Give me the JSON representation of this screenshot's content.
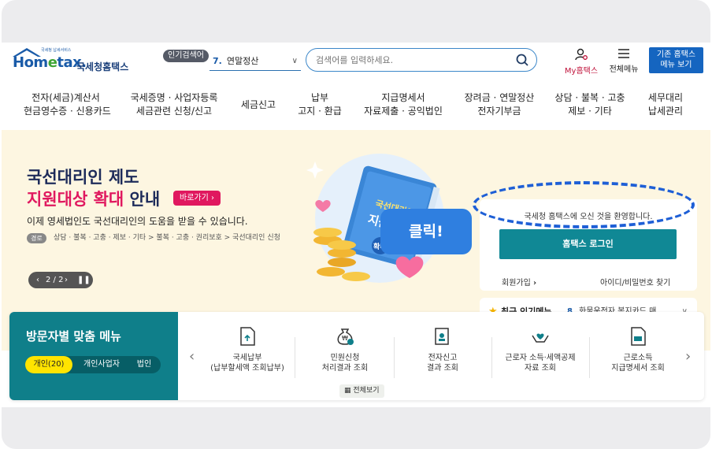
{
  "header": {
    "logo": {
      "brand_pre": "Hom",
      "brand_e": "e",
      "brand_post": "tax.",
      "brand_tiny": "국세청 납세서비스",
      "brand_ko": "국세청홈택스"
    },
    "popular_badge": "인기검색어",
    "popular_rank": "7.",
    "popular_term": "연말정산",
    "search": {
      "placeholder": "검색어를 입력하세요."
    },
    "my_hometax": "My홈택스",
    "all_menu": "전체메뉴",
    "legacy_line1": "기존 홈택스",
    "legacy_line2": "메뉴 보기"
  },
  "nav": [
    {
      "l1": "전자(세금)계산서",
      "l2": "현금영수증 · 신용카드"
    },
    {
      "l1": "국세증명 · 사업자등록",
      "l2": "세금관련 신청/신고"
    },
    {
      "l1": "세금신고",
      "l2": ""
    },
    {
      "l1": "납부",
      "l2": "고지 · 환급"
    },
    {
      "l1": "지급명세서",
      "l2": "자료제출 · 공익법인"
    },
    {
      "l1": "장려금 · 연말정산",
      "l2": "전자기부금"
    },
    {
      "l1": "상담 · 불복 · 고충",
      "l2": "제보 · 기타"
    },
    {
      "l1": "세무대리",
      "l2": "납세관리"
    }
  ],
  "hero": {
    "title1": "국선대리인 제도",
    "title2_pink": "지원대상 확대",
    "title2_rest": " 안내",
    "goto_label": "바로가기",
    "description": "이제 영세법인도 국선대리인의 도움을 받을 수 있습니다.",
    "path_badge": "경로",
    "path": "상담 · 불복 · 고충 · 제보 · 기타 > 불복 · 고충 · 권리보호 > 국선대리인 신청",
    "pager": "2 / 2",
    "book_line1": "국선대리인",
    "book_line2": "지원 대상",
    "book_line3": "확대",
    "click_label": "클릭!"
  },
  "login": {
    "message": "국세청 홈택스에 오신 것을 환영합니다.",
    "login_button": "홈택스 로그인",
    "join": "회원가입",
    "find": "아이디/비밀번호 찾기"
  },
  "popular_menu": {
    "title": "최근 인기메뉴",
    "rank": "8.",
    "value": "화물운전자 복지카드 매..."
  },
  "visitor": {
    "title": "방문자별 맞춤 메뉴",
    "tabs": [
      "개인(20)",
      "개인사업자",
      "법인"
    ],
    "items": [
      {
        "l1": "국세납부",
        "l2": "(납부할세액 조회납부)"
      },
      {
        "l1": "민원신청",
        "l2": "처리결과 조회"
      },
      {
        "l1": "전자신고",
        "l2": "결과 조회"
      },
      {
        "l1": "근로자 소득·세액공제",
        "l2": "자료 조회"
      },
      {
        "l1": "근로소득",
        "l2": "지급명세서 조회"
      }
    ],
    "all_view": "전체보기"
  },
  "colors": {
    "brand_blue": "#1a5ba8",
    "accent_pink": "#e0185f",
    "teal": "#108895",
    "hero_bg": "#fdf6e1",
    "click_blue": "#2f7fe0"
  }
}
